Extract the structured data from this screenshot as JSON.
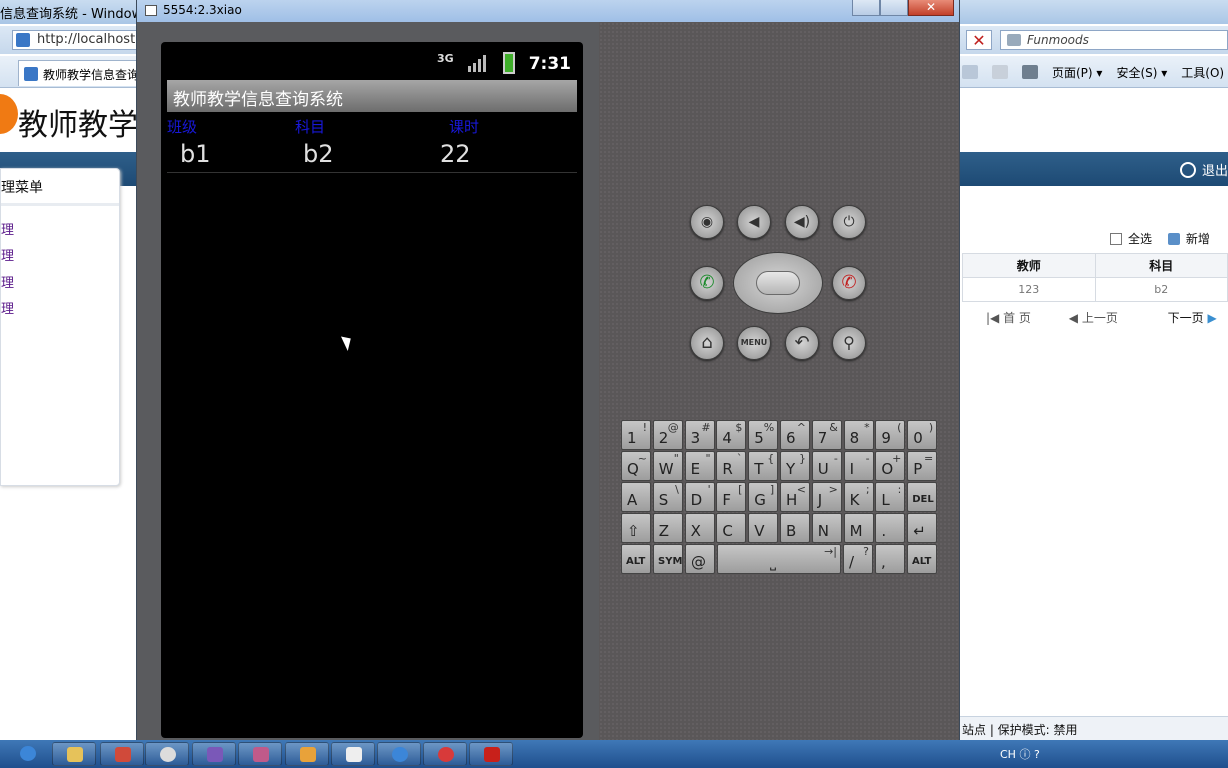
{
  "ie": {
    "title": "信息查询系统 - Window",
    "url": "http://localhost:8",
    "stop_glyph": "✕",
    "search_placeholder": "Funmoods",
    "tab_label": "教师教学信息查询",
    "cmd": {
      "page_label": "页面(P) ▾",
      "safety_label": "安全(S) ▾",
      "tools_label": "工具(O)"
    },
    "logo_text": "教师教学",
    "logout_label": "退出",
    "side_menu_title": "理菜单",
    "side_items": [
      "理",
      "理",
      "理",
      "理"
    ],
    "select_all_label": "全选",
    "add_label": "新增",
    "table_headers": [
      "教师",
      "科目"
    ],
    "table_row": [
      "123",
      "b2"
    ],
    "pager": {
      "first": "首 页",
      "prev": "上一页",
      "next": "下一页"
    },
    "status_text": "站点 | 保护模式: 禁用"
  },
  "emulator": {
    "title": "5554:2.3xiao",
    "close_glyph": "✕",
    "status": {
      "network": "3G",
      "time": "7:31"
    },
    "app_title": "教师教学信息查询系统",
    "columns": [
      "班级",
      "科目",
      "课时"
    ],
    "row": [
      "b1",
      "b2",
      "22"
    ],
    "buttons": {
      "camera": "◉",
      "vol_down": "◀",
      "vol_up": "◀)",
      "power": "⏻",
      "call": "✆",
      "end_call": "✆",
      "home": "⌂",
      "menu": "MENU",
      "back": "↶",
      "search": "⚲"
    }
  },
  "keyboard": {
    "rows": [
      [
        [
          "1",
          "!"
        ],
        [
          "2",
          "@"
        ],
        [
          "3",
          "#"
        ],
        [
          "4",
          "$"
        ],
        [
          "5",
          "%"
        ],
        [
          "6",
          "^"
        ],
        [
          "7",
          "&"
        ],
        [
          "8",
          "*"
        ],
        [
          "9",
          "("
        ],
        [
          "0",
          ")"
        ]
      ],
      [
        [
          "Q",
          "~"
        ],
        [
          "W",
          "\""
        ],
        [
          "E",
          "\""
        ],
        [
          "R",
          "`"
        ],
        [
          "T",
          "{"
        ],
        [
          "Y",
          "}"
        ],
        [
          "U",
          "-"
        ],
        [
          "I",
          "-"
        ],
        [
          "O",
          "+"
        ],
        [
          "P",
          "="
        ]
      ],
      [
        [
          "A",
          ""
        ],
        [
          "S",
          "\\"
        ],
        [
          "D",
          "'"
        ],
        [
          "F",
          "["
        ],
        [
          "G",
          "]"
        ],
        [
          "H",
          "<"
        ],
        [
          "J",
          ">"
        ],
        [
          "K",
          ";"
        ],
        [
          "L",
          ":"
        ],
        [
          "DEL",
          ""
        ]
      ],
      [
        [
          "⇧",
          ""
        ],
        [
          "Z",
          ""
        ],
        [
          "X",
          ""
        ],
        [
          "C",
          ""
        ],
        [
          "V",
          ""
        ],
        [
          "B",
          ""
        ],
        [
          "N",
          ""
        ],
        [
          "M",
          ""
        ],
        [
          ".",
          ""
        ],
        [
          "↵",
          ""
        ]
      ]
    ],
    "bottom": {
      "alt": "ALT",
      "sym": "SYM",
      "at": "@",
      "space": "⎵",
      "slash": "/",
      "q": "?",
      "comma": ",",
      "alt2": "ALT",
      "tab": "→|"
    }
  },
  "taskbar": {
    "tray_text": "CH ⓘ ?"
  }
}
